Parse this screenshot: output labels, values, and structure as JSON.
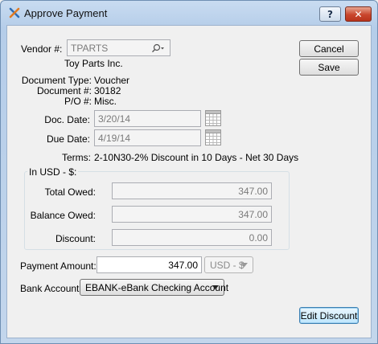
{
  "window": {
    "title": "Approve Payment",
    "help_glyph": "?",
    "close_glyph": "✕"
  },
  "vendor": {
    "label": "Vendor #:",
    "value": "TPARTS",
    "name": "Toy Parts Inc."
  },
  "document": {
    "type_label": "Document Type:",
    "type_value": "Voucher",
    "number_label": "Document #:",
    "number_value": "30182",
    "po_label": "P/O #:",
    "po_value": "Misc."
  },
  "dates": {
    "doc_label": "Doc. Date:",
    "doc_value": "3/20/14",
    "due_label": "Due Date:",
    "due_value": "4/19/14"
  },
  "terms": {
    "label": "Terms:",
    "value": "2-10N30-2% Discount in 10 Days - Net 30 Days"
  },
  "amounts": {
    "group_label": "In USD - $:",
    "total_owed_label": "Total Owed:",
    "total_owed": "347.00",
    "balance_owed_label": "Balance Owed:",
    "balance_owed": "347.00",
    "discount_label": "Discount:",
    "discount": "0.00"
  },
  "payment": {
    "label": "Payment Amount:",
    "value": "347.00",
    "currency": "USD - $"
  },
  "bank": {
    "label": "Bank Account:",
    "value": "EBANK-eBank Checking Account"
  },
  "buttons": {
    "cancel": "Cancel",
    "save": "Save",
    "edit_discount": "Edit Discount"
  },
  "colors": {
    "title_bg": "#b5cde9",
    "close_red": "#c9462c",
    "focus_blue": "#3c7fb1"
  }
}
